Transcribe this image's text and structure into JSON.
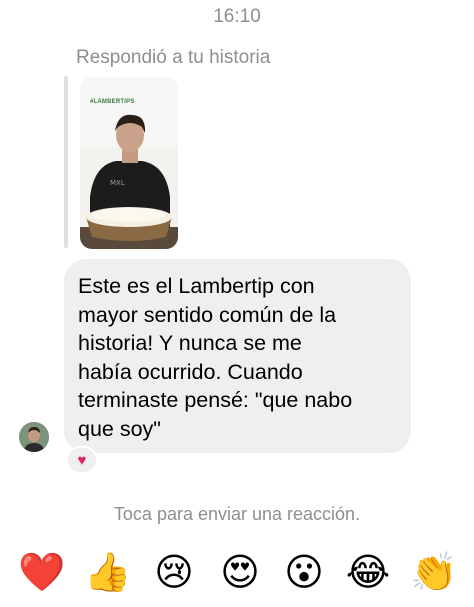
{
  "conversation": {
    "timestamp": "16:10",
    "story_reply_label": "Respondió a tu historia",
    "story_tag": "#LAMBERTIPS",
    "message_lines": [
      "Este es el Lambertip con",
      "mayor sentido común de la",
      "historia! Y nunca se me",
      "había ocurrido. Cuando",
      "terminaste pensé: \"que nabo",
      "que soy\""
    ],
    "message_reaction": "♥",
    "reaction_hint": "Toca para enviar una reacción."
  },
  "reactions": [
    {
      "name": "heart",
      "glyph": "❤️"
    },
    {
      "name": "thumbs-up",
      "glyph": "👍"
    },
    {
      "name": "crying-face",
      "glyph": "😢"
    },
    {
      "name": "heart-eyes",
      "glyph": "😍"
    },
    {
      "name": "surprised-face",
      "glyph": "😮"
    },
    {
      "name": "laughing-face",
      "glyph": "😂"
    },
    {
      "name": "clapping-hands",
      "glyph": "👏"
    }
  ],
  "colors": {
    "bubble": "#efefef",
    "secondary_text": "#8e8e93",
    "heart": "#e0245e"
  }
}
